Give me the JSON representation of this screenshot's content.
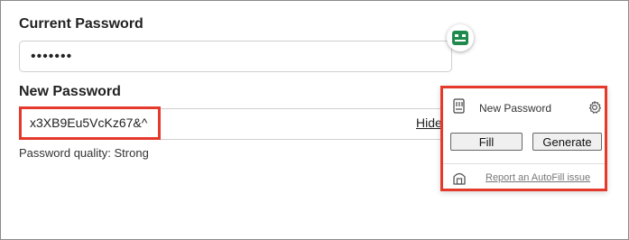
{
  "form": {
    "current_password_label": "Current Password",
    "current_password_value": "•••••••",
    "new_password_label": "New Password",
    "new_password_value": "x3XB9Eu5VcKz67&^",
    "hide_label": "Hide",
    "quality_text": "Password quality: Strong"
  },
  "popup": {
    "title": "New Password",
    "fill_label": "Fill",
    "generate_label": "Generate",
    "report_link": "Report an AutoFill issue"
  },
  "colors": {
    "highlight": "#e4392b",
    "extension_green": "#1f8a4c"
  },
  "icons": {
    "extension": "password-manager-icon",
    "key_card": "key-card-icon",
    "settings": "gear-icon",
    "vault": "vault-icon"
  }
}
